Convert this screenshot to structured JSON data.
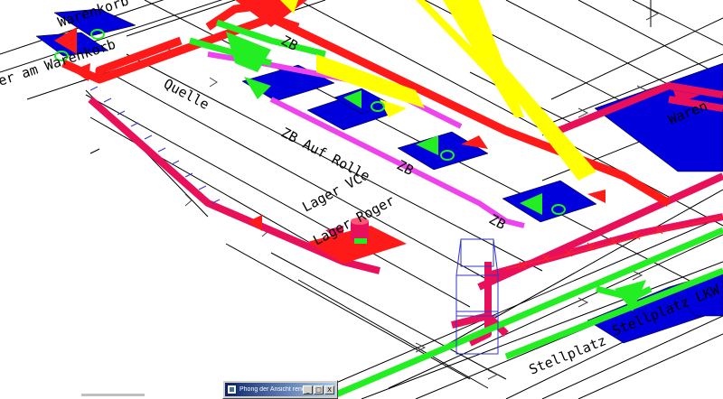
{
  "scene": {
    "labels": {
      "warenkorb_top": "Warenkorb",
      "warenkorb_left": "er am Warenkorb",
      "quelle": "Quelle",
      "zb_top": "ZB",
      "zentralbuero": "ZB Auf Rolle",
      "zb_lower": "ZB",
      "zb_bottom": "ZB",
      "lager_vc": "Lager VC",
      "lager_roger": "Lager Roger",
      "stellplatz": "Stellplatz",
      "stellplatz_lkw": "Stellplatz LKW",
      "waren_right": "Waren"
    },
    "colors": {
      "red": "#ff1a1a",
      "crimson": "#e8105a",
      "green": "#22ee22",
      "magenta": "#ee44ee",
      "yellow": "#ffff00",
      "blue": "#0000dd",
      "line": "#000000"
    }
  },
  "status_window": {
    "title": "Phong der Ansicht rendern",
    "icon": "render-app-icon",
    "buttons": [
      "_",
      "□",
      "X"
    ]
  }
}
